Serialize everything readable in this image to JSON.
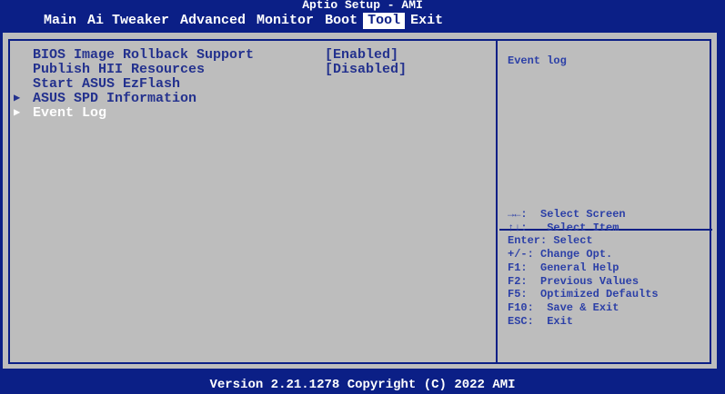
{
  "header": {
    "title": "Aptio Setup - AMI",
    "tabs": [
      {
        "label": "Main"
      },
      {
        "label": "Ai Tweaker"
      },
      {
        "label": "Advanced"
      },
      {
        "label": "Monitor"
      },
      {
        "label": "Boot"
      },
      {
        "label": "Tool"
      },
      {
        "label": "Exit"
      }
    ],
    "active_tab": "Tool"
  },
  "main": {
    "items": [
      {
        "label": "BIOS Image Rollback Support",
        "value": "[Enabled]",
        "submenu": false
      },
      {
        "label": "Publish HII Resources",
        "value": "[Disabled]",
        "submenu": false
      },
      {
        "label": "Start ASUS EzFlash",
        "value": "",
        "submenu": false
      },
      {
        "label": "ASUS SPD Information",
        "value": "",
        "submenu": true
      },
      {
        "label": "Event Log",
        "value": "",
        "submenu": true
      }
    ],
    "selected_index": 4
  },
  "help": {
    "title": "Event log",
    "keys": [
      "→←:  Select Screen",
      "↑↓:   Select Item",
      "Enter: Select",
      "+/-: Change Opt.",
      "F1:  General Help",
      "F2:  Previous Values",
      "F5:  Optimized Defaults",
      "F10:  Save & Exit",
      "ESC:  Exit"
    ]
  },
  "footer": {
    "text": "Version 2.21.1278 Copyright (C) 2022 AMI"
  },
  "colors": {
    "background_blue": "#0b1f86",
    "panel_gray": "#bdbdbd",
    "text_blue": "#23318e",
    "highlight_white": "#ffffff"
  },
  "icons": {
    "submenu_marker": "triangle-right-icon"
  }
}
